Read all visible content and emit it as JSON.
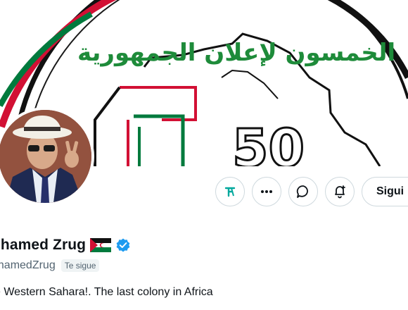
{
  "banner": {
    "arabic_text": "الخمسون لإعلان الجمهورية",
    "anniversary_number": "50"
  },
  "profile": {
    "display_name": "ohamed Zrug",
    "handle": "ohamedZrug",
    "follows_you_label": "Te sigue",
    "bio": "e Western Sahara!. The last colony in Africa",
    "verified": true
  },
  "actions": {
    "follow_label": "Sigui",
    "icons": [
      "grok-icon",
      "more-icon",
      "message-icon",
      "notification-bell-icon"
    ]
  },
  "colors": {
    "accent_blue": "#1d9bf0",
    "border": "#cfd9de",
    "secondary_text": "#536471",
    "flag_red": "#d21034",
    "flag_green": "#007a3d"
  }
}
